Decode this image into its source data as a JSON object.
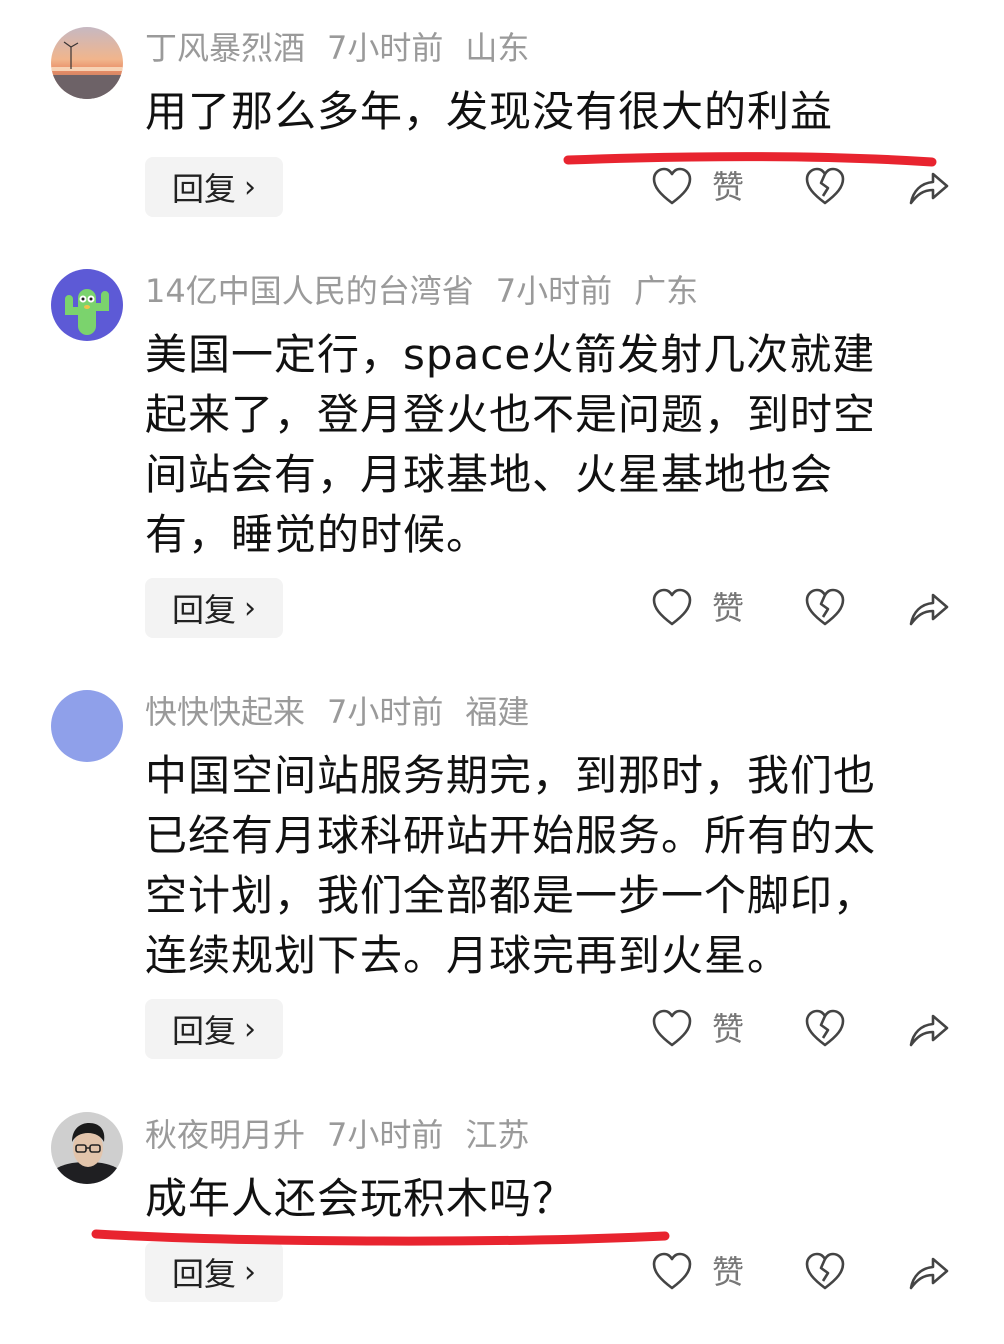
{
  "comments": [
    {
      "username": "丁风暴烈酒",
      "time": "7小时前",
      "location": "山东",
      "avatar": "sunset-landscape-avatar",
      "lines": [
        "用了那么多年，发现没有很大的利益"
      ],
      "reply_label": "回复",
      "like_label": "赞"
    },
    {
      "username": "14亿中国人民的台湾省",
      "time": "7小时前",
      "location": "广东",
      "avatar": "cactus-avatar",
      "lines": [
        "美国一定行，space火箭发射几次就建",
        "起来了，登月登火也不是问题，到时空",
        "间站会有，月球基地、火星基地也会",
        "有，睡觉的时候。"
      ],
      "reply_label": "回复",
      "like_label": "赞"
    },
    {
      "username": "快快快起来",
      "time": "7小时前",
      "location": "福建",
      "avatar": "blue-circle-avatar",
      "lines": [
        "中国空间站服务期完，到那时，我们也",
        "已经有月球科研站开始服务。所有的太",
        "空计划，我们全部都是一步一个脚印，",
        "连续规划下去。月球完再到火星。"
      ],
      "reply_label": "回复",
      "like_label": "赞"
    },
    {
      "username": "秋夜明月升",
      "time": "7小时前",
      "location": "江苏",
      "avatar": "man-portrait-avatar",
      "lines": [
        "成年人还会玩积木吗？"
      ],
      "reply_label": "回复",
      "like_label": "赞"
    }
  ],
  "icons": {
    "reply_chevron": "chevron-right-icon",
    "like": "heart-icon",
    "dislike": "broken-heart-icon",
    "share": "share-arrow-icon"
  },
  "colors": {
    "annotation_underline": "#e8242f",
    "meta_text": "#9a9a9a",
    "reply_bg": "#f3f3f3"
  }
}
